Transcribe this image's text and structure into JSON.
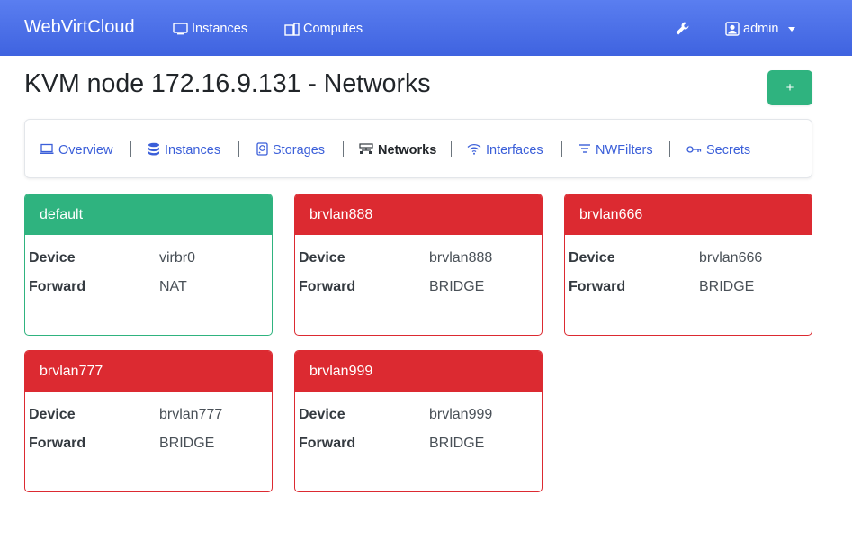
{
  "navbar": {
    "brand": "WebVirtCloud",
    "links": [
      {
        "label": "Instances",
        "icon": "desktop-icon"
      },
      {
        "label": "Computes",
        "icon": "server-icon"
      }
    ],
    "tools_icon": "wrench-icon",
    "user": {
      "label": "admin",
      "icon": "user-icon"
    }
  },
  "header": {
    "title": "KVM node 172.16.9.131 - Networks",
    "add_button": "+"
  },
  "subnav": {
    "items": [
      {
        "label": "Overview",
        "icon": "laptop-icon",
        "active": false
      },
      {
        "label": "Instances",
        "icon": "database-icon",
        "active": false
      },
      {
        "label": "Storages",
        "icon": "hdd-icon",
        "active": false
      },
      {
        "label": "Networks",
        "icon": "sitemap-icon",
        "active": true
      },
      {
        "label": "Interfaces",
        "icon": "wifi-icon",
        "active": false
      },
      {
        "label": "NWFilters",
        "icon": "filter-icon",
        "active": false
      },
      {
        "label": "Secrets",
        "icon": "key-icon",
        "active": false
      }
    ]
  },
  "labels": {
    "device": "Device",
    "forward": "Forward"
  },
  "networks": [
    {
      "name": "default",
      "device": "virbr0",
      "forward": "NAT",
      "status": "active"
    },
    {
      "name": "brvlan888",
      "device": "brvlan888",
      "forward": "BRIDGE",
      "status": "inactive"
    },
    {
      "name": "brvlan666",
      "device": "brvlan666",
      "forward": "BRIDGE",
      "status": "inactive"
    },
    {
      "name": "brvlan777",
      "device": "brvlan777",
      "forward": "BRIDGE",
      "status": "inactive"
    },
    {
      "name": "brvlan999",
      "device": "brvlan999",
      "forward": "BRIDGE",
      "status": "inactive"
    }
  ],
  "colors": {
    "navbar": "#4a6ee8",
    "active": "#2fb37f",
    "inactive": "#dc2a31",
    "link": "#3b5fd9"
  }
}
